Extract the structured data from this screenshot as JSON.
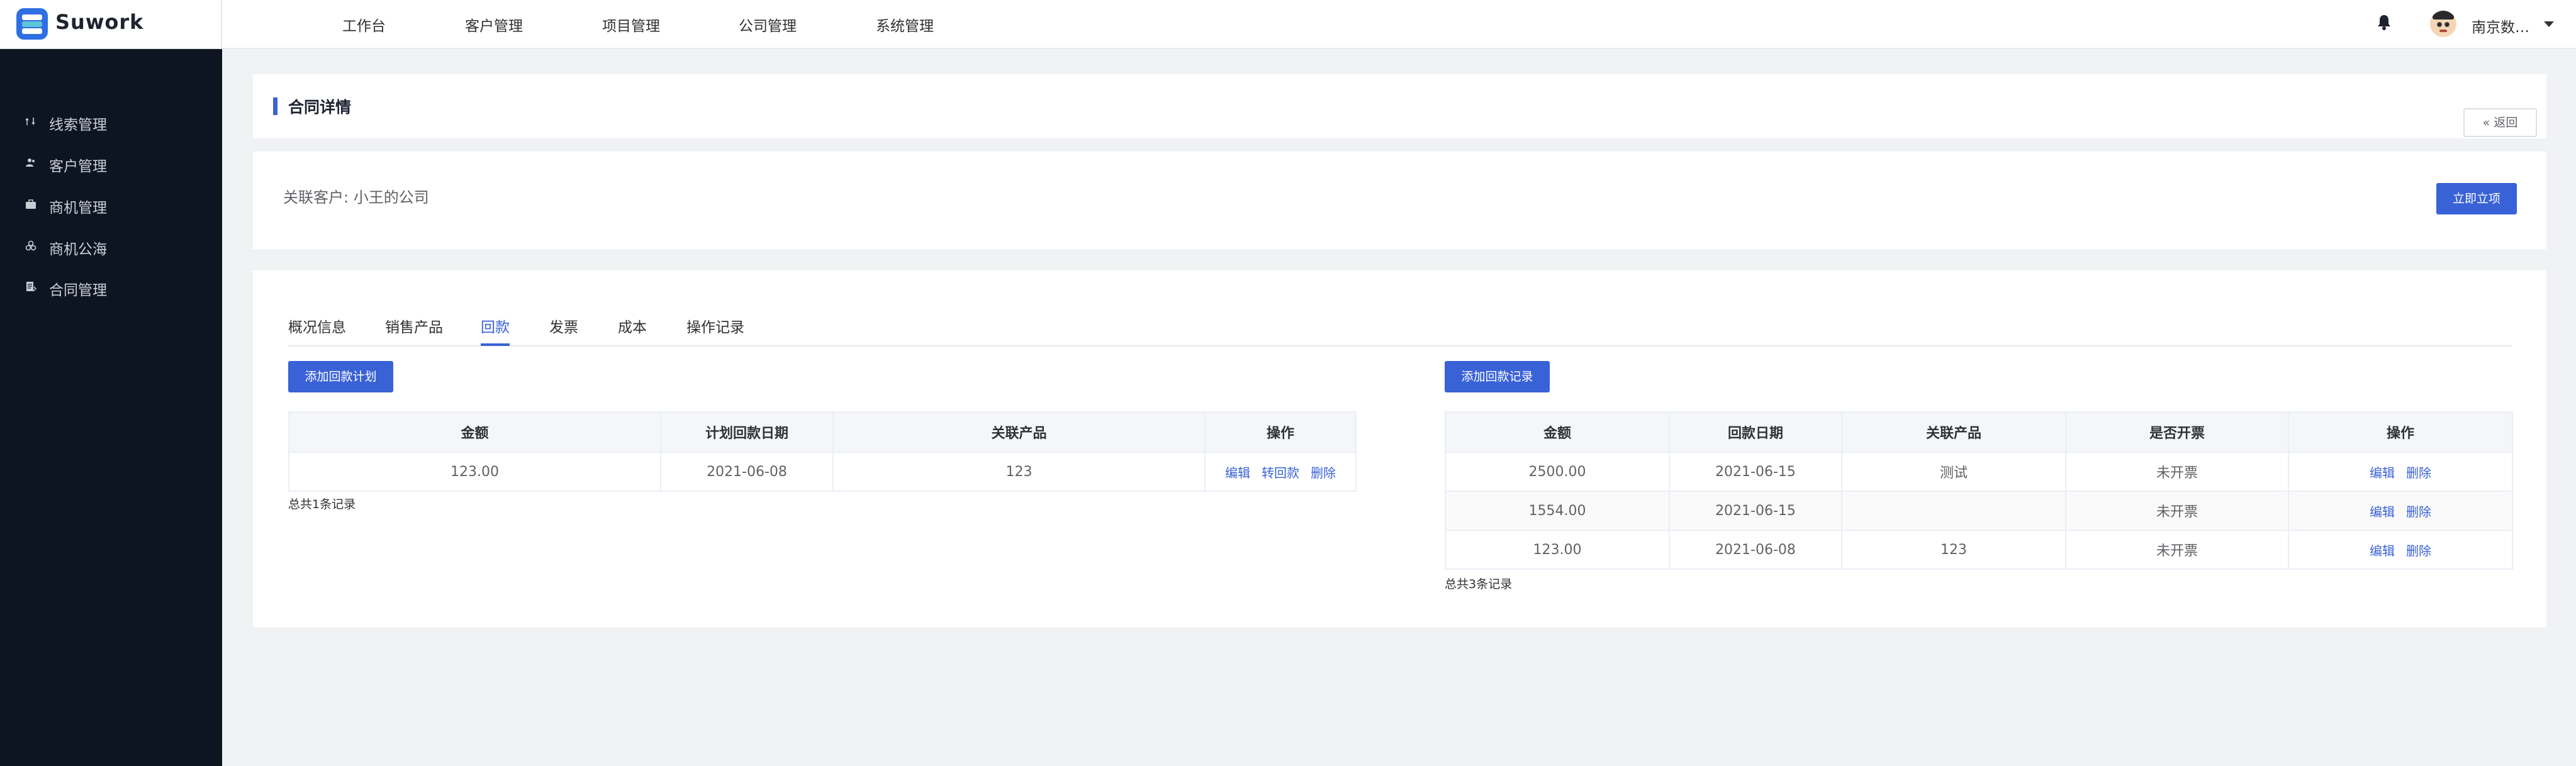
{
  "app": {
    "name": "Suwork",
    "brand_color": "#3a62d7",
    "sidebar_bg": "#0e1522"
  },
  "topnav": [
    {
      "label": "工作台"
    },
    {
      "label": "客户管理"
    },
    {
      "label": "项目管理"
    },
    {
      "label": "公司管理"
    },
    {
      "label": "系统管理"
    }
  ],
  "header": {
    "bell_icon": "bell-icon",
    "user_name": "南京数…"
  },
  "sidebar": {
    "items": [
      {
        "label": "线索管理",
        "icon": "clue-icon"
      },
      {
        "label": "客户管理",
        "icon": "customer-icon"
      },
      {
        "label": "商机管理",
        "icon": "briefcase-icon"
      },
      {
        "label": "商机公海",
        "icon": "pool-icon"
      },
      {
        "label": "合同管理",
        "icon": "contract-icon"
      }
    ]
  },
  "page": {
    "title": "合同详情",
    "back_label": "返回",
    "related_customer": "关联客户: 小王的公司",
    "approve_button": "立即立项"
  },
  "tabs": [
    {
      "label": "概况信息",
      "active": false
    },
    {
      "label": "销售产品",
      "active": false
    },
    {
      "label": "回款",
      "active": true
    },
    {
      "label": "发票",
      "active": false
    },
    {
      "label": "成本",
      "active": false
    },
    {
      "label": "操作记录",
      "active": false
    }
  ],
  "plan_table": {
    "add_button": "添加回款计划",
    "columns": [
      "金额",
      "计划回款日期",
      "关联产品",
      "操作"
    ],
    "rows": [
      {
        "amount": "123.00",
        "date": "2021-06-08",
        "product": "123"
      }
    ],
    "actions": [
      "编辑",
      "转回款",
      "删除"
    ],
    "total": "总共1条记录"
  },
  "record_table": {
    "add_button": "添加回款记录",
    "columns": [
      "金额",
      "回款日期",
      "关联产品",
      "是否开票",
      "操作"
    ],
    "rows": [
      {
        "amount": "2500.00",
        "date": "2021-06-15",
        "product": "测试",
        "invoiced": "未开票"
      },
      {
        "amount": "1554.00",
        "date": "2021-06-15",
        "product": "",
        "invoiced": "未开票"
      },
      {
        "amount": "123.00",
        "date": "2021-06-08",
        "product": "123",
        "invoiced": "未开票"
      }
    ],
    "actions": [
      "编辑",
      "删除"
    ],
    "total": "总共3条记录"
  }
}
